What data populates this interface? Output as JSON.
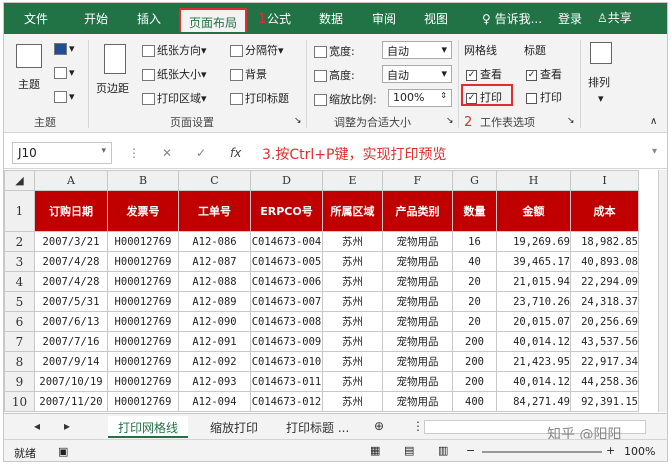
{
  "ribbon_tabs": [
    "文件",
    "开始",
    "插入",
    "页面布局",
    "公式",
    "数据",
    "审阅",
    "视图"
  ],
  "active_tab": "页面布局",
  "tell_me": "告诉我...",
  "login": "登录",
  "share": "共享",
  "ribbon": {
    "theme": {
      "label": "主题",
      "group": "主题"
    },
    "page_setup": {
      "margins": "页边距",
      "orientation": "纸张方向",
      "size": "纸张大小",
      "print_area": "打印区域",
      "breaks": "分隔符",
      "background": "背景",
      "print_titles": "打印标题",
      "group": "页面设置"
    },
    "scale": {
      "width_label": "宽度:",
      "width_value": "自动",
      "height_label": "高度:",
      "height_value": "自动",
      "scale_label": "缩放比例:",
      "scale_value": "100%",
      "group": "调整为合适大小"
    },
    "sheet_options": {
      "gridlines": "网格线",
      "headings": "标题",
      "view": "查看",
      "print": "打印",
      "group": "工作表选项"
    },
    "arrange": {
      "label": "排列"
    }
  },
  "annotations": {
    "step1": "1",
    "step2": "2",
    "formula_note": "3.按Ctrl+P键，实现打印预览"
  },
  "name_box": "J10",
  "columns": [
    "A",
    "B",
    "C",
    "D",
    "E",
    "F",
    "G",
    "H",
    "I"
  ],
  "rows": [
    "1",
    "2",
    "3",
    "4",
    "5",
    "6",
    "7",
    "8",
    "9",
    "10"
  ],
  "headers": [
    "订购日期",
    "发票号",
    "工单号",
    "ERPCO号",
    "所属区域",
    "产品类别",
    "数量",
    "金额",
    "成本"
  ],
  "data": [
    [
      "2007/3/21",
      "H00012769",
      "A12-086",
      "C014673-004",
      "苏州",
      "宠物用品",
      "16",
      "19,269.69",
      "18,982.85"
    ],
    [
      "2007/4/28",
      "H00012769",
      "A12-087",
      "C014673-005",
      "苏州",
      "宠物用品",
      "40",
      "39,465.17",
      "40,893.08"
    ],
    [
      "2007/4/28",
      "H00012769",
      "A12-088",
      "C014673-006",
      "苏州",
      "宠物用品",
      "20",
      "21,015.94",
      "22,294.09"
    ],
    [
      "2007/5/31",
      "H00012769",
      "A12-089",
      "C014673-007",
      "苏州",
      "宠物用品",
      "20",
      "23,710.26",
      "24,318.37"
    ],
    [
      "2007/6/13",
      "H00012769",
      "A12-090",
      "C014673-008",
      "苏州",
      "宠物用品",
      "20",
      "20,015.07",
      "20,256.69"
    ],
    [
      "2007/7/16",
      "H00012769",
      "A12-091",
      "C014673-009",
      "苏州",
      "宠物用品",
      "200",
      "40,014.12",
      "43,537.56"
    ],
    [
      "2007/9/14",
      "H00012769",
      "A12-092",
      "C014673-010",
      "苏州",
      "宠物用品",
      "200",
      "21,423.95",
      "22,917.34"
    ],
    [
      "2007/10/19",
      "H00012769",
      "A12-093",
      "C014673-011",
      "苏州",
      "宠物用品",
      "200",
      "40,014.12",
      "44,258.36"
    ],
    [
      "2007/11/20",
      "H00012769",
      "A12-094",
      "C014673-012",
      "苏州",
      "宠物用品",
      "400",
      "84,271.49",
      "92,391.15"
    ]
  ],
  "sheet_tabs": [
    "打印网格线",
    "缩放打印",
    "打印标题 ..."
  ],
  "status_ready": "就绪",
  "zoom": "100%",
  "watermark": "知乎 @阳阳",
  "colors": {
    "excel_green": "#217346",
    "header_red": "#c00000",
    "annotation_red": "#e02e2e"
  }
}
